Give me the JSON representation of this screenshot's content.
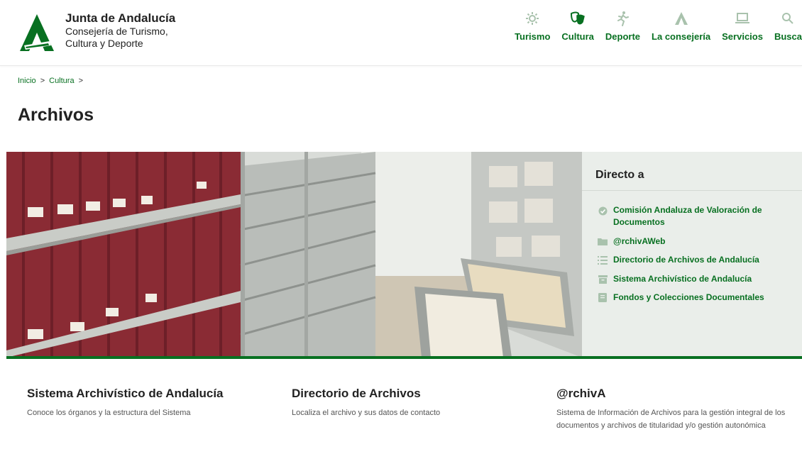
{
  "header": {
    "title": "Junta de Andalucía",
    "subtitle_line1": "Consejería de Turismo,",
    "subtitle_line2": "Cultura y Deporte",
    "nav": [
      {
        "label": "Turismo",
        "icon": "sun-icon"
      },
      {
        "label": "Cultura",
        "icon": "theater-masks-icon"
      },
      {
        "label": "Deporte",
        "icon": "runner-icon"
      },
      {
        "label": "La consejería",
        "icon": "junta-logo-icon"
      },
      {
        "label": "Servicios",
        "icon": "laptop-icon"
      },
      {
        "label": "Busca",
        "icon": "search-icon"
      }
    ],
    "active_nav": "Cultura"
  },
  "breadcrumb": {
    "items": [
      "Inicio",
      "Cultura"
    ],
    "separator": ">"
  },
  "page": {
    "title": "Archivos"
  },
  "directo": {
    "title": "Directo a",
    "links": [
      {
        "label": "Comisión Andaluza de Valoración de Documentos",
        "icon": "check-circle-icon"
      },
      {
        "label": "@rchivAWeb",
        "icon": "folder-icon"
      },
      {
        "label": "Directorio de Archivos de Andalucía",
        "icon": "list-icon"
      },
      {
        "label": "Sistema Archivístico de Andalucía",
        "icon": "archive-box-icon"
      },
      {
        "label": "Fondos y Colecciones Documentales",
        "icon": "book-icon"
      }
    ]
  },
  "cards": [
    {
      "title": "Sistema Archivístico de Andalucía",
      "text": "Conoce los órganos y la estructura del Sistema"
    },
    {
      "title": "Directorio de Archivos",
      "text": "Localiza el archivo y sus datos de contacto"
    },
    {
      "title": "@rchivA",
      "text": "Sistema de Información de Archivos para la gestión integral de los documentos y archivos de titularidad y/o gestión autonómica"
    }
  ],
  "colors": {
    "brand_green": "#087021",
    "panel_bg": "#eaeeea",
    "icon_grey": "#a9c2ad"
  }
}
